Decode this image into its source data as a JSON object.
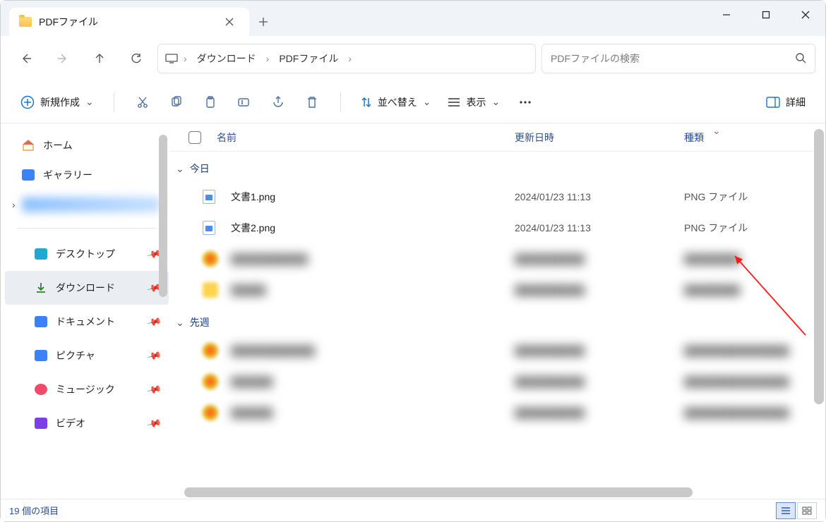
{
  "window": {
    "tab_title": "PDFファイル"
  },
  "breadcrumbs": {
    "seg1": "ダウンロード",
    "seg2": "PDFファイル"
  },
  "search": {
    "placeholder": "PDFファイルの検索"
  },
  "toolbar": {
    "new_label": "新規作成",
    "sort_label": "並べ替え",
    "view_label": "表示",
    "details_label": "詳細"
  },
  "columns": {
    "name": "名前",
    "date": "更新日時",
    "type": "種類"
  },
  "sidebar": {
    "home": "ホーム",
    "gallery": "ギャラリー",
    "desktop": "デスクトップ",
    "downloads": "ダウンロード",
    "documents": "ドキュメント",
    "pictures": "ピクチャ",
    "music": "ミュージック",
    "videos": "ビデオ"
  },
  "groups": {
    "today": "今日",
    "lastweek": "先週"
  },
  "files": {
    "today": [
      {
        "name": "文書1.png",
        "date": "2024/01/23 11:13",
        "type": "PNG ファイル"
      },
      {
        "name": "文書2.png",
        "date": "2024/01/23 11:13",
        "type": "PNG ファイル"
      }
    ]
  },
  "status": {
    "count_text": "19 個の項目"
  }
}
